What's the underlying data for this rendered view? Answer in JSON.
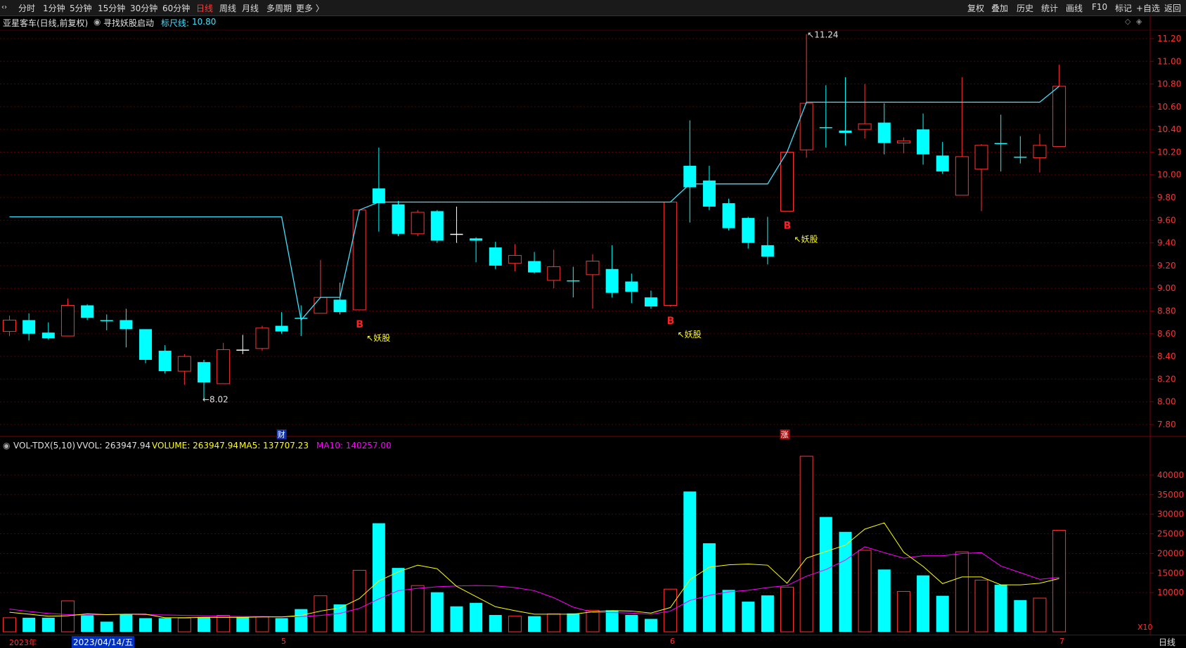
{
  "toolbar": {
    "left_items": [
      "分时",
      "1分钟",
      "5分钟",
      "15分钟",
      "30分钟",
      "60分钟",
      "日线",
      "周线",
      "月线",
      "多周期",
      "更多 〉"
    ],
    "active": "日线",
    "right_items": [
      "复权",
      "叠加",
      "历史",
      "统计",
      "画线",
      "F10",
      "标记",
      "+自选",
      "返回"
    ]
  },
  "header": {
    "stock": "亚星客车(日线,前复权)",
    "formula": "寻找妖股启动",
    "ruler_label": "标尺线:",
    "ruler_value": "10.80"
  },
  "price_axis": [
    "11.20",
    "11.00",
    "10.80",
    "10.60",
    "10.40",
    "10.20",
    "10.00",
    "9.80",
    "9.60",
    "9.40",
    "9.20",
    "9.00",
    "8.80",
    "8.60",
    "8.40",
    "8.20",
    "8.00",
    "7.80"
  ],
  "annotations": {
    "high": "11.24",
    "low": "8.02",
    "signal": "B",
    "tag": "妖股",
    "fin_marker": "财",
    "zhang_marker": "涨"
  },
  "volume_header": {
    "name": "VOL-TDX(5,10)",
    "vvol": "VVOL: 263947.94",
    "volume": "VOLUME: 263947.94",
    "ma5": "MA5: 137707.23",
    "ma10": "MA10: 140257.00"
  },
  "volume_axis": [
    "40000",
    "35000",
    "30000",
    "25000",
    "20000",
    "15000",
    "10000"
  ],
  "volume_unit": "X10",
  "date_axis": {
    "year": "2023年",
    "cursor_date": "2023/04/14/五",
    "months": [
      "5",
      "6",
      "7"
    ]
  },
  "period_label": "日线",
  "colors": {
    "up": "#ff3232",
    "down": "#00ffff",
    "line": "#40e0ff",
    "ma5": "#ffff00",
    "ma10": "#ff00ff"
  },
  "chart_data": {
    "type": "candlestick",
    "candles": [
      {
        "o": 8.62,
        "c": 8.72,
        "h": 8.76,
        "l": 8.58
      },
      {
        "o": 8.72,
        "c": 8.6,
        "h": 8.78,
        "l": 8.54
      },
      {
        "o": 8.61,
        "c": 8.56,
        "h": 8.7,
        "l": 8.55
      },
      {
        "o": 8.58,
        "c": 8.85,
        "h": 8.91,
        "l": 8.58
      },
      {
        "o": 8.85,
        "c": 8.74,
        "h": 8.86,
        "l": 8.72
      },
      {
        "o": 8.72,
        "c": 8.72,
        "h": 8.77,
        "l": 8.63
      },
      {
        "o": 8.72,
        "c": 8.64,
        "h": 8.82,
        "l": 8.48
      },
      {
        "o": 8.64,
        "c": 8.37,
        "h": 8.64,
        "l": 8.34
      },
      {
        "o": 8.45,
        "c": 8.27,
        "h": 8.5,
        "l": 8.25
      },
      {
        "o": 8.27,
        "c": 8.4,
        "h": 8.42,
        "l": 8.15
      },
      {
        "o": 8.35,
        "c": 8.17,
        "h": 8.37,
        "l": 8.02
      },
      {
        "o": 8.16,
        "c": 8.46,
        "h": 8.52,
        "l": 8.16
      },
      {
        "o": 8.46,
        "c": 8.46,
        "h": 8.59,
        "l": 8.42
      },
      {
        "o": 8.47,
        "c": 8.65,
        "h": 8.67,
        "l": 8.45
      },
      {
        "o": 8.67,
        "c": 8.62,
        "h": 8.79,
        "l": 8.6
      },
      {
        "o": 8.74,
        "c": 8.74,
        "h": 8.85,
        "l": 8.58
      },
      {
        "o": 8.78,
        "c": 8.92,
        "h": 9.25,
        "l": 8.78
      },
      {
        "o": 8.9,
        "c": 8.79,
        "h": 9.05,
        "l": 8.77
      },
      {
        "o": 8.81,
        "c": 9.69,
        "h": 9.69,
        "l": 8.81
      },
      {
        "o": 9.88,
        "c": 9.75,
        "h": 10.24,
        "l": 9.5
      },
      {
        "o": 9.74,
        "c": 9.48,
        "h": 9.77,
        "l": 9.46
      },
      {
        "o": 9.48,
        "c": 9.67,
        "h": 9.69,
        "l": 9.46
      },
      {
        "o": 9.68,
        "c": 9.42,
        "h": 9.69,
        "l": 9.4
      },
      {
        "o": 9.48,
        "c": 9.48,
        "h": 9.72,
        "l": 9.4
      },
      {
        "o": 9.44,
        "c": 9.42,
        "h": 9.45,
        "l": 9.23
      },
      {
        "o": 9.36,
        "c": 9.2,
        "h": 9.41,
        "l": 9.17
      },
      {
        "o": 9.22,
        "c": 9.29,
        "h": 9.39,
        "l": 9.15
      },
      {
        "o": 9.24,
        "c": 9.14,
        "h": 9.32,
        "l": 9.13
      },
      {
        "o": 9.07,
        "c": 9.19,
        "h": 9.34,
        "l": 9.0
      },
      {
        "o": 9.07,
        "c": 9.07,
        "h": 9.19,
        "l": 8.92
      },
      {
        "o": 9.12,
        "c": 9.24,
        "h": 9.3,
        "l": 8.82
      },
      {
        "o": 9.17,
        "c": 8.96,
        "h": 9.38,
        "l": 8.92
      },
      {
        "o": 9.06,
        "c": 8.97,
        "h": 9.13,
        "l": 8.87
      },
      {
        "o": 8.92,
        "c": 8.84,
        "h": 8.98,
        "l": 8.82
      },
      {
        "o": 8.85,
        "c": 9.76,
        "h": 9.76,
        "l": 8.84
      },
      {
        "o": 10.08,
        "c": 9.89,
        "h": 10.48,
        "l": 9.58
      },
      {
        "o": 9.95,
        "c": 9.72,
        "h": 10.08,
        "l": 9.69
      },
      {
        "o": 9.75,
        "c": 9.53,
        "h": 9.79,
        "l": 9.51
      },
      {
        "o": 9.62,
        "c": 9.4,
        "h": 9.63,
        "l": 9.35
      },
      {
        "o": 9.38,
        "c": 9.28,
        "h": 9.63,
        "l": 9.21
      },
      {
        "o": 9.68,
        "c": 10.2,
        "h": 10.2,
        "l": 9.68
      },
      {
        "o": 10.22,
        "c": 10.63,
        "h": 11.24,
        "l": 10.15
      },
      {
        "o": 10.42,
        "c": 10.42,
        "h": 10.79,
        "l": 10.24
      },
      {
        "o": 10.39,
        "c": 10.37,
        "h": 10.86,
        "l": 10.26
      },
      {
        "o": 10.4,
        "c": 10.45,
        "h": 10.8,
        "l": 10.32
      },
      {
        "o": 10.46,
        "c": 10.28,
        "h": 10.63,
        "l": 10.18
      },
      {
        "o": 10.28,
        "c": 10.3,
        "h": 10.33,
        "l": 10.19
      },
      {
        "o": 10.4,
        "c": 10.18,
        "h": 10.54,
        "l": 10.09
      },
      {
        "o": 10.17,
        "c": 10.03,
        "h": 10.29,
        "l": 10.01
      },
      {
        "o": 9.82,
        "c": 10.16,
        "h": 10.86,
        "l": 9.82
      },
      {
        "o": 10.05,
        "c": 10.26,
        "h": 10.27,
        "l": 9.68
      },
      {
        "o": 10.28,
        "c": 10.28,
        "h": 10.53,
        "l": 10.03
      },
      {
        "o": 10.16,
        "c": 10.16,
        "h": 10.34,
        "l": 10.1
      },
      {
        "o": 10.15,
        "c": 10.26,
        "h": 10.36,
        "l": 10.02
      },
      {
        "o": 10.25,
        "c": 10.78,
        "h": 10.97,
        "l": 10.25
      }
    ],
    "ruler_line": [
      9.63,
      9.63,
      9.63,
      9.63,
      9.63,
      9.63,
      9.63,
      9.63,
      9.63,
      9.63,
      9.63,
      9.63,
      9.63,
      9.63,
      9.63,
      8.72,
      8.92,
      8.92,
      9.69,
      9.76,
      9.76,
      9.76,
      9.76,
      9.76,
      9.76,
      9.76,
      9.76,
      9.76,
      9.76,
      9.76,
      9.76,
      9.76,
      9.76,
      9.76,
      9.76,
      9.92,
      9.92,
      9.92,
      9.92,
      9.92,
      10.2,
      10.64,
      10.64,
      10.64,
      10.64,
      10.64,
      10.64,
      10.64,
      10.64,
      10.64,
      10.64,
      10.64,
      10.64,
      10.64,
      10.78
    ],
    "volume": [
      3600,
      3600,
      3600,
      7900,
      4200,
      2600,
      4400,
      3500,
      3500,
      3500,
      3800,
      4200,
      3800,
      3800,
      3500,
      5800,
      9200,
      7000,
      15700,
      27700,
      16300,
      11800,
      10100,
      6500,
      7400,
      4300,
      4000,
      4000,
      4600,
      4700,
      5500,
      5500,
      4300,
      3300,
      10900,
      35800,
      22600,
      10700,
      7700,
      9300,
      11400,
      44800,
      29300,
      25500,
      20800,
      15900,
      10300,
      14400,
      9200,
      20400,
      13200,
      12000,
      8100,
      8600,
      25900
    ],
    "ma5": [
      5000,
      4500,
      4000,
      4100,
      4600,
      4400,
      4500,
      4500,
      3600,
      3600,
      3700,
      3700,
      3700,
      3800,
      3800,
      4200,
      5300,
      6100,
      8500,
      13000,
      15300,
      17000,
      16100,
      11600,
      9000,
      6400,
      5400,
      4500,
      4500,
      4500,
      5100,
      5400,
      5300,
      4800,
      6200,
      13300,
      16500,
      17100,
      17300,
      17000,
      12400,
      18800,
      20500,
      22100,
      26200,
      27800,
      20300,
      16700,
      12300,
      14000,
      14000,
      12000,
      12000,
      12400,
      13600
    ],
    "ma10": [
      5800,
      5200,
      4700,
      4400,
      4300,
      4400,
      4500,
      4400,
      4300,
      4200,
      4100,
      4000,
      3900,
      3900,
      3800,
      3900,
      4200,
      4700,
      6000,
      8400,
      10500,
      11100,
      11500,
      11700,
      11800,
      11700,
      11300,
      10500,
      8700,
      6300,
      5000,
      4900,
      4800,
      4500,
      5300,
      8000,
      9300,
      10200,
      10600,
      11300,
      11800,
      14200,
      15900,
      18300,
      21700,
      20200,
      18800,
      19400,
      19400,
      20000,
      20200,
      16800,
      15100,
      13400,
      13900
    ],
    "signals": [
      {
        "index": 18,
        "label": "B"
      },
      {
        "index": 34,
        "label": "B"
      },
      {
        "index": 40,
        "label": "B"
      }
    ],
    "tags": [
      18,
      34,
      40
    ]
  }
}
